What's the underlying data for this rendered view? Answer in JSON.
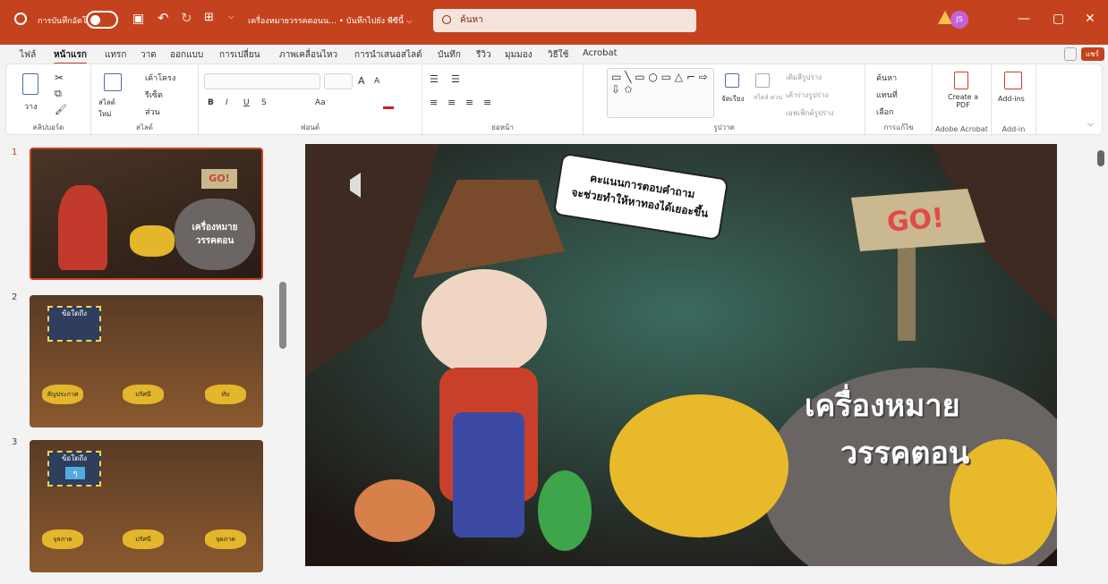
{
  "titlebar": {
    "autosave_label": "การบันทึกอัตโนมัติ",
    "doc_title": "เครื่องหมายวรรคตอนน... • บันทึกไปยัง พีซีนี้ ⌵",
    "search_placeholder": "ค้นหา",
    "avatar_initials": "JS",
    "accent": "#c4421e"
  },
  "menu": {
    "tabs": [
      "ไฟล์",
      "หน้าแรก",
      "แทรก",
      "วาด",
      "ออกแบบ",
      "การเปลี่ยน",
      "ภาพเคลื่อนไหว",
      "การนำเสนอสไลด์",
      "บันทึก",
      "รีวิว",
      "มุมมอง",
      "วิธีใช้",
      "Acrobat"
    ],
    "active": "หน้าแรก",
    "share": "แชร์"
  },
  "ribbon": {
    "clipboard": {
      "paste": "วาง",
      "label": "คลิปบอร์ด"
    },
    "slides": {
      "new_slide": "สไลด์ ใหม่",
      "layout": "เค้าโครง",
      "reset": "รีเซ็ต",
      "section": "ส่วน",
      "label": "สไลด์"
    },
    "font": {
      "label": "ฟอนต์",
      "bold": "B",
      "italic": "I",
      "underline": "U",
      "strike": "S",
      "size_up": "A",
      "size_down": "A",
      "case": "Aa"
    },
    "paragraph": {
      "label": "ย่อหน้า"
    },
    "drawing": {
      "arrange": "จัดเรียง",
      "styles": "สไตล์ ด่วน",
      "fill": "เติมสีรูปร่าง",
      "outline": "เค้าร่างรูปร่าง",
      "effects": "เอฟเฟ็กต์รูปร่าง",
      "label": "รูปวาด"
    },
    "editing": {
      "find": "ค้นหา",
      "replace": "แทนที่",
      "select": "เลือก",
      "label": "การแก้ไข"
    },
    "acrobat": {
      "create": "Create a PDF",
      "label": "Adobe Acrobat"
    },
    "addins": {
      "button": "Add-ins",
      "label": "Add-in"
    }
  },
  "thumbnails": {
    "numbers": [
      "1",
      "2",
      "3"
    ],
    "slide1": {
      "title": "เครื่องหมาย วรรคตอน",
      "sign": "GO!"
    },
    "slide2": {
      "box": "ข้อใดถึง",
      "options": [
        "สัญประกาศ",
        "ปรัศนี",
        "ทับ"
      ]
    },
    "slide3": {
      "box": "ข้อใดถึง",
      "symbol": "ๆ",
      "options": [
        "จุลภาค",
        "ปรัศนี",
        "จุดภาค"
      ]
    }
  },
  "slide": {
    "bubble_line1": "คะแนนการตอบคำถาม",
    "bubble_line2": "จะช่วยทำให้หาทองได้เยอะขึ้น",
    "sign": "GO!",
    "title_line1": "เครื่องหมาย",
    "title_line2": "วรรคตอน"
  }
}
